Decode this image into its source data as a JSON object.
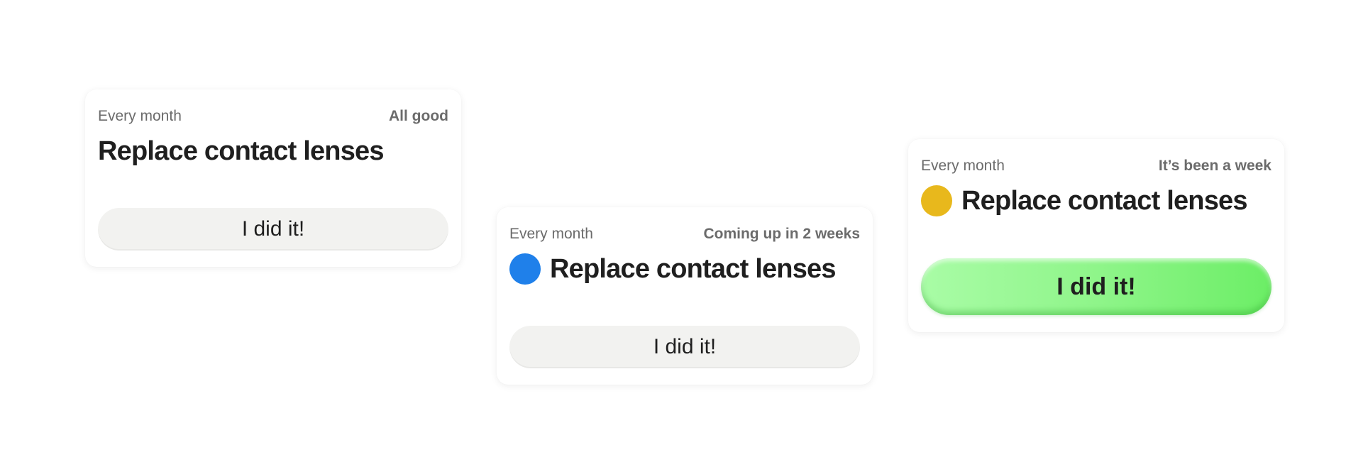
{
  "cards": [
    {
      "frequency": "Every month",
      "status": "All good",
      "title": "Replace contact lenses",
      "button_label": "I did it!",
      "dot_color": null
    },
    {
      "frequency": "Every month",
      "status": "Coming up in 2 weeks",
      "title": "Replace contact lenses",
      "button_label": "I did it!",
      "dot_color": "#1f80ea"
    },
    {
      "frequency": "Every month",
      "status": "It’s been a week",
      "title": "Replace contact lenses",
      "button_label": "I did it!",
      "dot_color": "#e8b81c",
      "button_color": "#7cf276"
    }
  ]
}
